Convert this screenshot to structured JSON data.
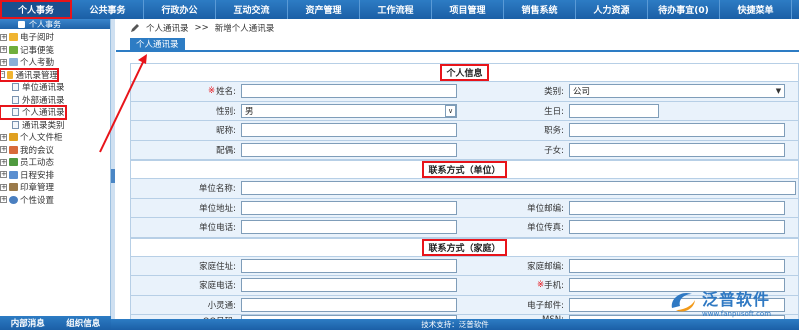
{
  "topnav": {
    "items": [
      "个人事务",
      "公共事务",
      "行政办公",
      "互动交流",
      "资产管理",
      "工作流程",
      "项目管理",
      "销售系统",
      "人力资源",
      "待办事宜(0)",
      "快捷菜单"
    ]
  },
  "sidebar": {
    "header": "个人事务",
    "tree": [
      {
        "label": "电子阅时"
      },
      {
        "label": "记事便笺"
      },
      {
        "label": "个人考勤"
      },
      {
        "label": "通讯录管理"
      },
      {
        "label": "单位通讯录"
      },
      {
        "label": "外部通讯录"
      },
      {
        "label": "个人通讯录"
      },
      {
        "label": "通讯录类别"
      },
      {
        "label": "个人文件柜"
      },
      {
        "label": "我的会议"
      },
      {
        "label": "员工动态"
      },
      {
        "label": "日程安排"
      },
      {
        "label": "印章管理"
      },
      {
        "label": "个性设置"
      }
    ],
    "footer": [
      "内部消息",
      "组织信息"
    ]
  },
  "content": {
    "breadcrumb": [
      "个人通讯录",
      ">>",
      "新增个人通讯录"
    ],
    "tab": "个人通讯录"
  },
  "form": {
    "sec1": "个人信息",
    "name_label": "姓名:",
    "category_label": "类别:",
    "category_value": "公司",
    "gender_label": "性别:",
    "gender_value": "男",
    "birthday_label": "生日:",
    "nickname_label": "昵称:",
    "job_label": "职务:",
    "spouse_label": "配偶:",
    "children_label": "子女:",
    "sec2": "联系方式（单位）",
    "company_label": "单位名称:",
    "company_addr_label": "单位地址:",
    "company_zip_label": "单位邮编:",
    "company_phone_label": "单位电话:",
    "company_fax_label": "单位传真:",
    "sec3": "联系方式（家庭）",
    "home_addr_label": "家庭住址:",
    "home_zip_label": "家庭邮编:",
    "home_phone_label": "家庭电话:",
    "mobile_label": "手机:",
    "phs_label": "小灵通:",
    "email_label": "电子邮件:",
    "qq_label": "QQ号码:",
    "msn_label": "MSN:"
  },
  "footer": {
    "support": "技术支持：泛普软件"
  },
  "watermark": {
    "name": "泛普软件",
    "url": "www.fanpusoft.com"
  },
  "colors": {
    "nav_blue": "#2d7cc4",
    "highlight_red": "#e8141a",
    "row_bg": "#e9f2fb"
  }
}
